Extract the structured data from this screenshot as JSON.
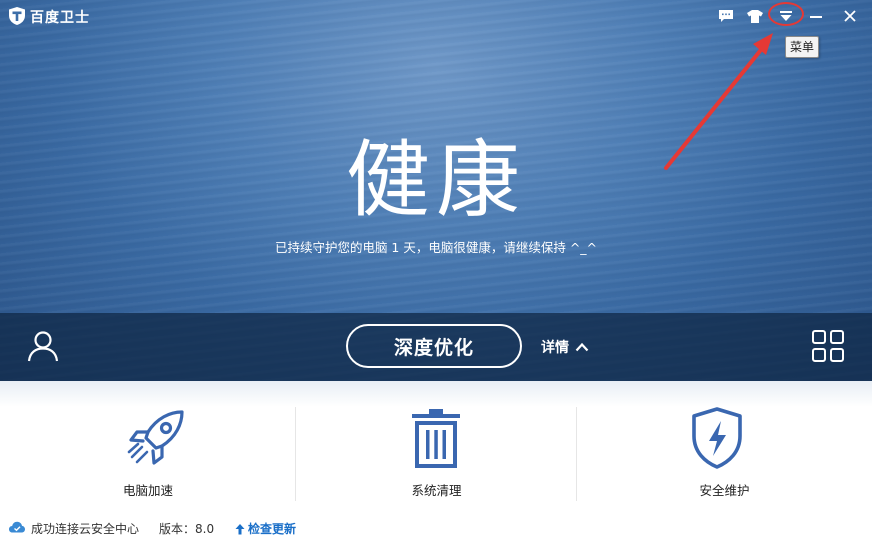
{
  "app": {
    "title": "百度卫士"
  },
  "titlebar": {
    "icons": [
      "feedback-icon",
      "skin-icon",
      "menu-dropdown-icon",
      "minimize-icon",
      "close-icon"
    ],
    "menu_tooltip": "菜单"
  },
  "hero": {
    "status": "健康",
    "description": "已持续守护您的电脑 1 天，电脑很健康，请继续保持 ^_^"
  },
  "actionbar": {
    "optimize_label": "深度优化",
    "details_label": "详情"
  },
  "tiles": [
    {
      "label": "电脑加速",
      "icon": "rocket-icon"
    },
    {
      "label": "系统清理",
      "icon": "trash-icon"
    },
    {
      "label": "安全维护",
      "icon": "shield-icon"
    }
  ],
  "statusbar": {
    "connection": "成功连接云安全中心",
    "version": "版本：8.0",
    "update": "检查更新"
  },
  "colors": {
    "accent_blue": "#3a67b0",
    "annotation_red": "#e53935",
    "link_blue": "#1a6fc8"
  }
}
